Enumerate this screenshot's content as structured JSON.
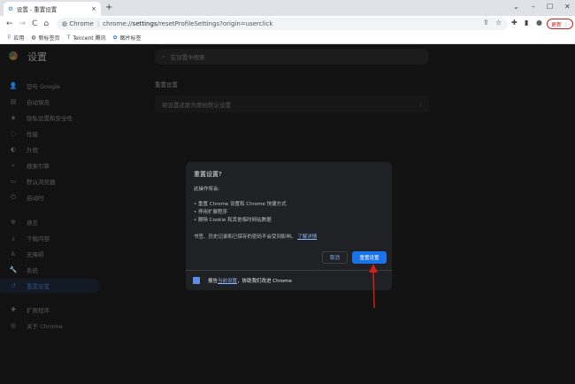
{
  "tab": {
    "title": "设置 - 重置设置",
    "close": "×"
  },
  "window": {
    "new_tab": "+",
    "dropdown": "⌄",
    "minimize": "–",
    "maximize": "☐",
    "close": "✕"
  },
  "toolbar": {
    "back": "←",
    "forward": "→",
    "reload": "C",
    "home": "⌂",
    "site": "Chrome",
    "url_prefix": "chrome://",
    "url_bold": "settings",
    "url_rest": "/resetProfileSettings?origin=userclick",
    "share": "⇪",
    "star": "☆",
    "extensions": "✚",
    "sidebar": "▮",
    "profile": "●",
    "update": "更新 ⋮"
  },
  "bookmarks": [
    {
      "icon": "⠿",
      "label": "应用"
    },
    {
      "icon": "◍",
      "label": "新标签页"
    },
    {
      "icon": "T",
      "label": "Tencent 腾讯"
    },
    {
      "icon": "✿",
      "label": "图片标签"
    }
  ],
  "settings": {
    "title": "设置",
    "search_placeholder": "在设置中搜索",
    "sidebar": [
      {
        "icon": "👤",
        "label": "您与 Google"
      },
      {
        "icon": "▤",
        "label": "自动填充"
      },
      {
        "icon": "◈",
        "label": "隐私设置和安全性"
      },
      {
        "icon": "◌",
        "label": "性能"
      },
      {
        "icon": "◐",
        "label": "外观"
      },
      {
        "icon": "⌕",
        "label": "搜索引擎"
      },
      {
        "icon": "▭",
        "label": "默认浏览器"
      },
      {
        "icon": "⏻",
        "label": "启动时"
      },
      {
        "icon": "⊕",
        "label": "语言"
      },
      {
        "icon": "⤓",
        "label": "下载内容"
      },
      {
        "icon": "♿",
        "label": "无障碍"
      },
      {
        "icon": "🔧",
        "label": "系统"
      },
      {
        "icon": "↺",
        "label": "重置设置"
      },
      {
        "icon": "✚",
        "label": "扩展程序"
      },
      {
        "icon": "◎",
        "label": "关于 Chrome"
      }
    ],
    "section_title": "重置设置",
    "card_label": "将设置还原为原始默认设置",
    "card_chevron": "›"
  },
  "dialog": {
    "title": "重置设置?",
    "intro": "此操作将会:",
    "bullets": [
      "• 重置 Chrome 设置和 Chrome 快捷方式",
      "• 停用扩展程序",
      "• 删除 Cookie 和其他临时网站数据"
    ],
    "note": "书签、历史记录和已保存的密码不会受到影响。",
    "learn_more": "了解详情",
    "cancel": "取消",
    "reset": "重置设置",
    "report_prefix": "报告",
    "report_link": "当前设置",
    "report_suffix": "，协助我们改进 Chrome",
    "checkbox_checked": true
  },
  "annotation": {
    "color": "#d0201a"
  }
}
